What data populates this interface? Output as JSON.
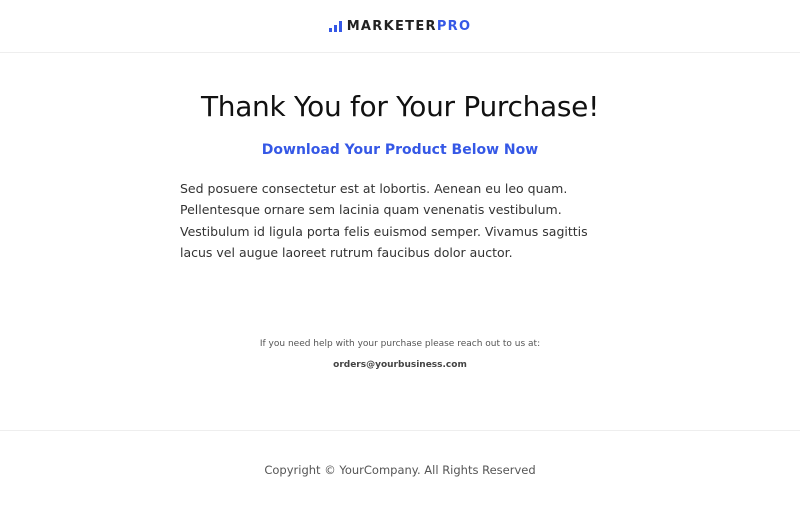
{
  "header": {
    "logo_prefix": "MARKETER",
    "logo_accent": "PRO",
    "logo_icon": "bar-chart-icon",
    "brand_color": "#3558e6"
  },
  "main": {
    "title": "Thank You for Your Purchase!",
    "subtitle": "Download Your Product Below Now",
    "body": "Sed posuere consectetur est at lobortis. Aenean eu leo quam. Pellentesque ornare sem lacinia quam venenatis vestibulum. Vestibulum id ligula porta felis euismod semper. Vivamus sagittis lacus vel augue laoreet rutrum faucibus dolor auctor."
  },
  "help": {
    "text": "If you need help with your purchase please reach out to us at:",
    "email": "orders@yourbusiness.com"
  },
  "footer": {
    "copyright": "Copyright © YourCompany. All Rights Reserved"
  }
}
